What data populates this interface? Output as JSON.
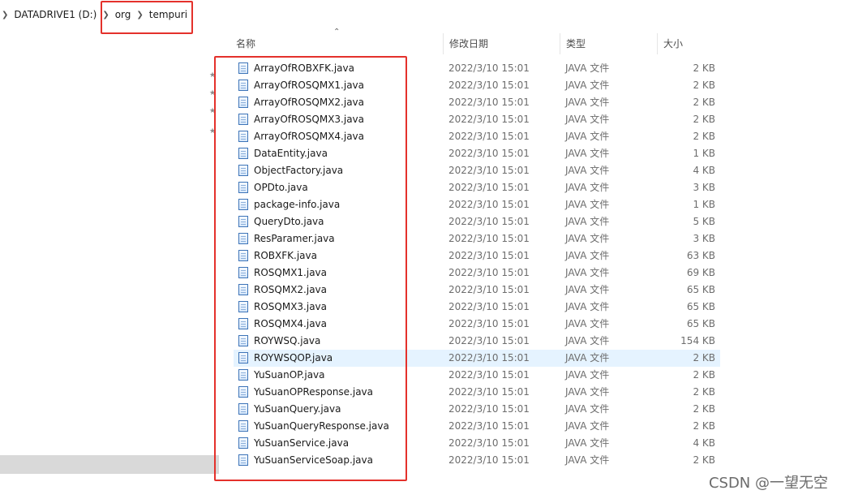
{
  "breadcrumb": {
    "drive": "DATADRIVE1 (D:)",
    "folders": [
      "org",
      "tempuri"
    ]
  },
  "columns": {
    "name": "名称",
    "modified": "修改日期",
    "type": "类型",
    "size": "大小"
  },
  "files": [
    {
      "name": "ArrayOfROBXFK.java",
      "modified": "2022/3/10 15:01",
      "type": "JAVA 文件",
      "size": "2 KB"
    },
    {
      "name": "ArrayOfROSQMX1.java",
      "modified": "2022/3/10 15:01",
      "type": "JAVA 文件",
      "size": "2 KB"
    },
    {
      "name": "ArrayOfROSQMX2.java",
      "modified": "2022/3/10 15:01",
      "type": "JAVA 文件",
      "size": "2 KB"
    },
    {
      "name": "ArrayOfROSQMX3.java",
      "modified": "2022/3/10 15:01",
      "type": "JAVA 文件",
      "size": "2 KB"
    },
    {
      "name": "ArrayOfROSQMX4.java",
      "modified": "2022/3/10 15:01",
      "type": "JAVA 文件",
      "size": "2 KB"
    },
    {
      "name": "DataEntity.java",
      "modified": "2022/3/10 15:01",
      "type": "JAVA 文件",
      "size": "1 KB"
    },
    {
      "name": "ObjectFactory.java",
      "modified": "2022/3/10 15:01",
      "type": "JAVA 文件",
      "size": "4 KB"
    },
    {
      "name": "OPDto.java",
      "modified": "2022/3/10 15:01",
      "type": "JAVA 文件",
      "size": "3 KB"
    },
    {
      "name": "package-info.java",
      "modified": "2022/3/10 15:01",
      "type": "JAVA 文件",
      "size": "1 KB"
    },
    {
      "name": "QueryDto.java",
      "modified": "2022/3/10 15:01",
      "type": "JAVA 文件",
      "size": "5 KB"
    },
    {
      "name": "ResParamer.java",
      "modified": "2022/3/10 15:01",
      "type": "JAVA 文件",
      "size": "3 KB"
    },
    {
      "name": "ROBXFK.java",
      "modified": "2022/3/10 15:01",
      "type": "JAVA 文件",
      "size": "63 KB"
    },
    {
      "name": "ROSQMX1.java",
      "modified": "2022/3/10 15:01",
      "type": "JAVA 文件",
      "size": "69 KB"
    },
    {
      "name": "ROSQMX2.java",
      "modified": "2022/3/10 15:01",
      "type": "JAVA 文件",
      "size": "65 KB"
    },
    {
      "name": "ROSQMX3.java",
      "modified": "2022/3/10 15:01",
      "type": "JAVA 文件",
      "size": "65 KB"
    },
    {
      "name": "ROSQMX4.java",
      "modified": "2022/3/10 15:01",
      "type": "JAVA 文件",
      "size": "65 KB"
    },
    {
      "name": "ROYWSQ.java",
      "modified": "2022/3/10 15:01",
      "type": "JAVA 文件",
      "size": "154 KB"
    },
    {
      "name": "ROYWSQOP.java",
      "modified": "2022/3/10 15:01",
      "type": "JAVA 文件",
      "size": "2 KB"
    },
    {
      "name": "YuSuanOP.java",
      "modified": "2022/3/10 15:01",
      "type": "JAVA 文件",
      "size": "2 KB"
    },
    {
      "name": "YuSuanOPResponse.java",
      "modified": "2022/3/10 15:01",
      "type": "JAVA 文件",
      "size": "2 KB"
    },
    {
      "name": "YuSuanQuery.java",
      "modified": "2022/3/10 15:01",
      "type": "JAVA 文件",
      "size": "2 KB"
    },
    {
      "name": "YuSuanQueryResponse.java",
      "modified": "2022/3/10 15:01",
      "type": "JAVA 文件",
      "size": "2 KB"
    },
    {
      "name": "YuSuanService.java",
      "modified": "2022/3/10 15:01",
      "type": "JAVA 文件",
      "size": "4 KB"
    },
    {
      "name": "YuSuanServiceSoap.java",
      "modified": "2022/3/10 15:01",
      "type": "JAVA 文件",
      "size": "2 KB"
    }
  ],
  "hovered_file": "ROYWSQOP.java",
  "icons": {
    "breadcrumb_separator": "chevron-right-icon",
    "file": "java-file-icon",
    "sort": "sort-ascending-icon",
    "pin": "pin-icon"
  },
  "colors": {
    "annotation_red": "#e4312b",
    "hover_row": "#e5f3ff",
    "nav_selected": "#d9d9d9"
  },
  "watermark": "CSDN @一望无空"
}
